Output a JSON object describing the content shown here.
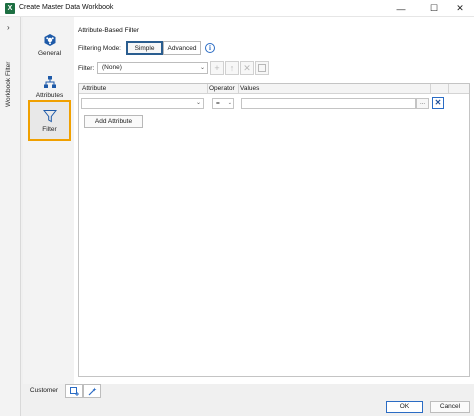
{
  "window": {
    "title": "Create Master Data Workbook",
    "app_icon_letter": "X",
    "minimize_glyph": "—",
    "maximize_glyph": "☐",
    "close_glyph": "✕"
  },
  "side_strip": {
    "chevron": "›",
    "label": "Workbook Filter"
  },
  "nav": {
    "items": [
      {
        "label": "General",
        "icon": "hexagon-cubes-icon"
      },
      {
        "label": "Attributes",
        "icon": "hierarchy-icon"
      },
      {
        "label": "Filter",
        "icon": "funnel-icon"
      }
    ],
    "selected": "Filter",
    "accent_color": "#f0a000",
    "icon_color": "#1e5aa8"
  },
  "content": {
    "section_title": "Attribute-Based Filter",
    "filtering_mode_label": "Filtering Mode:",
    "modes": [
      "Simple",
      "Advanced"
    ],
    "selected_mode": "Simple",
    "info_glyph": "i",
    "filter_label": "Filter:",
    "filter_value": "(None)",
    "toolbar_glyphs": [
      "+",
      "↑",
      "✕",
      ""
    ],
    "grid": {
      "columns": [
        "Attribute",
        "Operator",
        "Values"
      ],
      "row": {
        "attribute": "",
        "operator": "=",
        "values": ""
      },
      "ellipsis": "...",
      "remove_glyph": "✕"
    },
    "add_attribute_label": "Add Attribute"
  },
  "bottom": {
    "tab_label": "Customer"
  },
  "footer": {
    "ok_label": "OK",
    "cancel_label": "Cancel"
  }
}
